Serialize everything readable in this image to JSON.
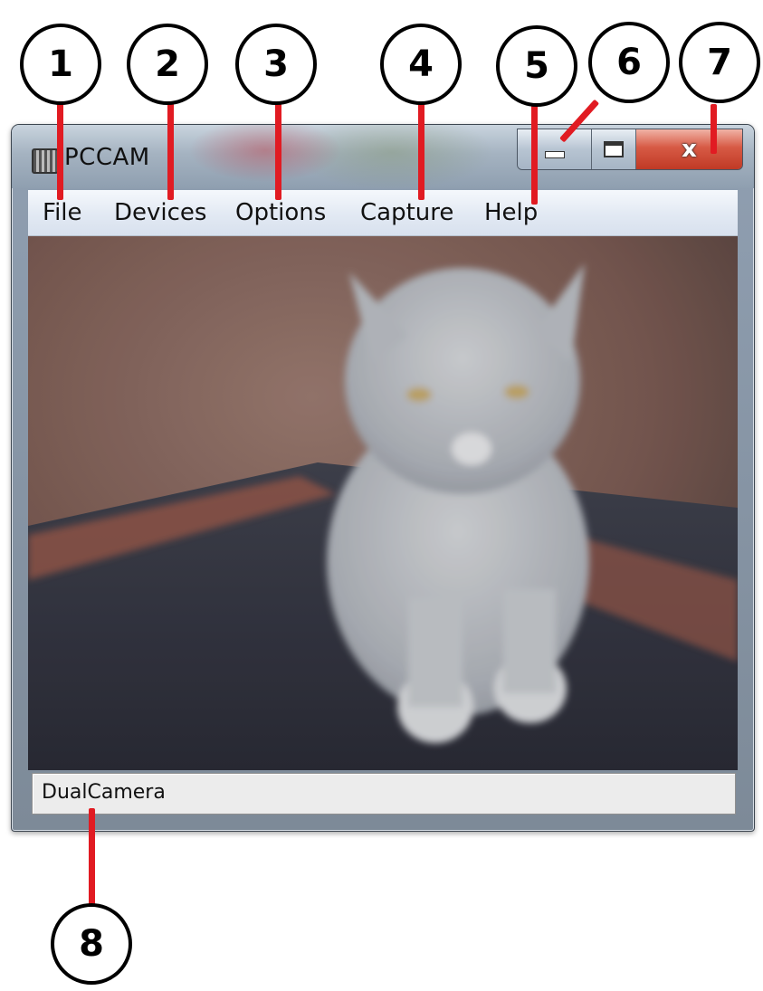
{
  "window": {
    "title": "PCCAM",
    "controls": {
      "minimize_icon": "minimize-icon",
      "maximize_icon": "maximize-icon",
      "close_glyph": "x"
    }
  },
  "menu": {
    "items": [
      {
        "label": "File"
      },
      {
        "label": "Devices"
      },
      {
        "label": "Options"
      },
      {
        "label": "Capture"
      },
      {
        "label": "Help"
      }
    ]
  },
  "camera_view": {
    "content": "live webcam preview"
  },
  "status_bar": {
    "text": "DualCamera"
  },
  "callouts": [
    "1",
    "2",
    "3",
    "4",
    "5",
    "6",
    "7",
    "8"
  ],
  "colors": {
    "leader_line": "#e11b22",
    "close_button": "#d75a45",
    "menu_bar": "#e2e9f3"
  }
}
